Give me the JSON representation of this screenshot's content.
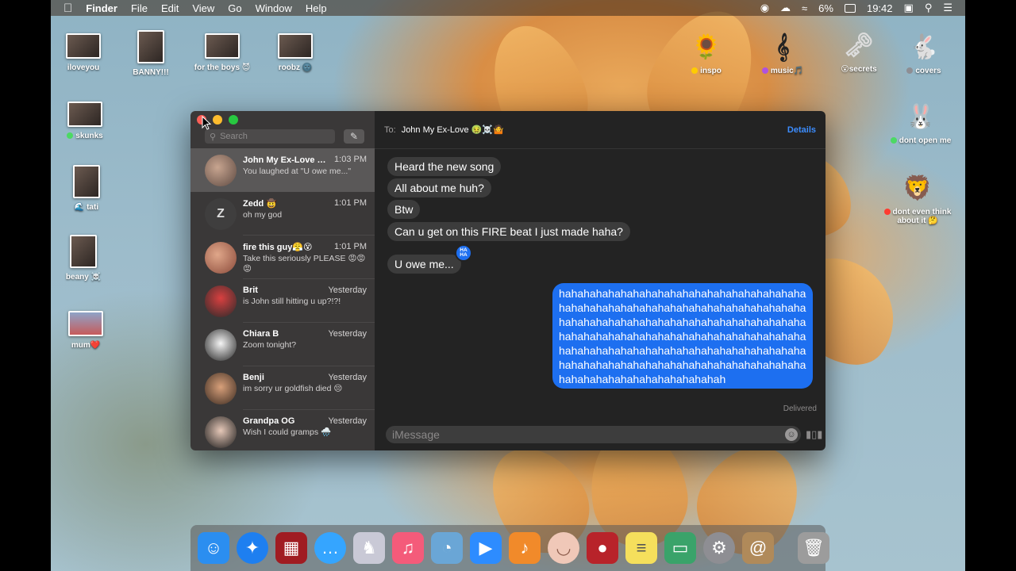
{
  "menubar": {
    "apple": "",
    "app": "Finder",
    "menus": [
      "File",
      "Edit",
      "View",
      "Go",
      "Window",
      "Help"
    ],
    "battery": "6%",
    "clock": "19:42"
  },
  "desktop_icons": [
    {
      "label": "iloveyou",
      "icon": "photo-thumbnail"
    },
    {
      "label": "BANNY!!!",
      "icon": "photo-thumbnail"
    },
    {
      "label": "for the boys 😈",
      "icon": "photo-thumbnail"
    },
    {
      "label": "roobz 🌚",
      "icon": "photo-thumbnail"
    },
    {
      "label": "skunks",
      "icon": "photo-thumbnail",
      "tag_color": "#4cd964"
    },
    {
      "label": "🌊 tati",
      "icon": "photo-thumbnail"
    },
    {
      "label": "beany ☠️",
      "icon": "photo-thumbnail"
    },
    {
      "label": "mum❤️",
      "icon": "photo-thumbnail"
    },
    {
      "label": "inspo",
      "icon": "sunflower-icon",
      "tag_color": "#ffcc00"
    },
    {
      "label": "music🎵",
      "icon": "treble-clef-icon",
      "tag_color": "#af52de"
    },
    {
      "label": "😮secrets",
      "icon": "key-icon"
    },
    {
      "label": "covers",
      "icon": "bunny-icon",
      "tag_color": "#8e8e93"
    },
    {
      "label": "dont open me",
      "icon": "rabbit-icon",
      "tag_color": "#4cd964"
    },
    {
      "label": "dont even think about it 🤔",
      "icon": "lion-icon",
      "tag_color": "#ff3b30"
    }
  ],
  "sidebar": {
    "search_placeholder": "Search",
    "conversations": [
      {
        "name": "John My Ex-Love 🤢...",
        "time": "1:03 PM",
        "preview": "You laughed at \"U owe me...\"",
        "selected": true
      },
      {
        "name": "Zedd 🤠",
        "time": "1:01 PM",
        "preview": "oh my god",
        "initial": "Z"
      },
      {
        "name": "fire this guy😤😵",
        "time": "1:01 PM",
        "preview": "Take this seriously PLEASE 😡😡😡"
      },
      {
        "name": "Brit",
        "time": "Yesterday",
        "preview": "is John still hitting u up?!?!"
      },
      {
        "name": "Chiara B",
        "time": "Yesterday",
        "preview": "Zoom tonight?"
      },
      {
        "name": "Benji",
        "time": "Yesterday",
        "preview": "im sorry ur goldfish died 😔"
      },
      {
        "name": "Grandpa OG",
        "time": "Yesterday",
        "preview": "Wish I could gramps 🌧️"
      }
    ]
  },
  "chat": {
    "to_label": "To:",
    "recipient": "John My Ex-Love 🤢☠️🤷",
    "details": "Details",
    "incoming": [
      "Heard the new song",
      "All about me huh?",
      "Btw",
      "Can u get on this FIRE beat I just made haha?",
      "U owe me..."
    ],
    "tapback": "HA HA",
    "outgoing": "hahahahahahahahahahahahahahahahahahahahahahahahahahahahahahahahahahahahahahahahahahahahahahahahahahahahahahahahahahahahahahahahahahahahahahahahahahahahahahahahahahahahahahahahahahahahahahahahahahahahahahahahahahahahahahahahahahahahahahahahahahahahahahahahahahahahahah",
    "status": "Delivered",
    "input_placeholder": "iMessage"
  },
  "dock": [
    {
      "name": "Finder",
      "icon": "finder-icon",
      "color": "#2b8ef0"
    },
    {
      "name": "Safari",
      "icon": "safari-icon",
      "color": "#1e7ff0"
    },
    {
      "name": "Photo Booth",
      "icon": "photo-booth-icon",
      "color": "#a01c22"
    },
    {
      "name": "Messages",
      "icon": "messages-icon",
      "color": "#35a5ff"
    },
    {
      "name": "Unicorn",
      "icon": "unicorn-icon",
      "color": "#c9c9d6"
    },
    {
      "name": "Music",
      "icon": "music-icon",
      "color": "#f45b7a"
    },
    {
      "name": "Seal",
      "icon": "seal-icon",
      "color": "#6aa6d6"
    },
    {
      "name": "Zoom",
      "icon": "zoom-icon",
      "color": "#2d8cff"
    },
    {
      "name": "GarageBand",
      "icon": "guitar-icon",
      "color": "#f18a2a"
    },
    {
      "name": "Face",
      "icon": "face-icon",
      "color": "#f0c8b8"
    },
    {
      "name": "Photo Booth Red",
      "icon": "camera-icon",
      "color": "#b8232a"
    },
    {
      "name": "Stickies",
      "icon": "stickies-icon",
      "color": "#f5df5c"
    },
    {
      "name": "Preview",
      "icon": "preview-icon",
      "color": "#3aa36a"
    },
    {
      "name": "System Preferences",
      "icon": "gear-icon",
      "color": "#8e8e93"
    },
    {
      "name": "Contacts",
      "icon": "contacts-icon",
      "color": "#b08a5a"
    },
    {
      "name": "Trash",
      "icon": "trash-icon",
      "color": "#9c9c9c"
    }
  ]
}
